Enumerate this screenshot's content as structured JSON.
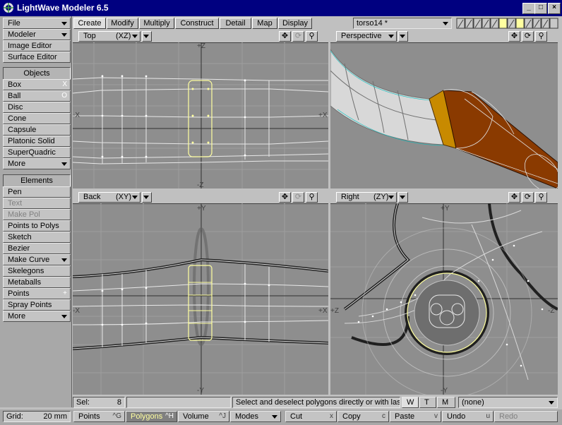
{
  "window": {
    "title": "LightWave Modeler 6.5"
  },
  "menus": {
    "file": "File",
    "modeler": "Modeler",
    "image_editor": "Image Editor",
    "surface_editor": "Surface Editor"
  },
  "objects": {
    "header": "Objects",
    "items": [
      {
        "label": "Box",
        "shortcut": "X"
      },
      {
        "label": "Ball",
        "shortcut": "O"
      },
      {
        "label": "Disc",
        "shortcut": ""
      },
      {
        "label": "Cone",
        "shortcut": ""
      },
      {
        "label": "Capsule",
        "shortcut": ""
      },
      {
        "label": "Platonic Solid",
        "shortcut": ""
      },
      {
        "label": "SuperQuadric",
        "shortcut": ""
      },
      {
        "label": "More",
        "shortcut": ""
      }
    ]
  },
  "elements": {
    "header": "Elements",
    "items": [
      {
        "label": "Pen"
      },
      {
        "label": "Text"
      },
      {
        "label": "Make Pol"
      },
      {
        "label": "Points to Polys"
      },
      {
        "label": "Sketch"
      },
      {
        "label": "Bezier"
      },
      {
        "label": "Make Curve"
      },
      {
        "label": "Skelegons"
      },
      {
        "label": "Metaballs"
      },
      {
        "label": "Points",
        "shortcut": "+"
      },
      {
        "label": "Spray Points"
      },
      {
        "label": "More"
      }
    ]
  },
  "tabs": [
    "Create",
    "Modify",
    "Multiply",
    "Construct",
    "Detail",
    "Map",
    "Display"
  ],
  "layer_select": "torso14 *",
  "viewports": {
    "top": {
      "label": "Top",
      "axes": "(XZ)",
      "axis_top": "+Z",
      "axis_bottom": "-Z",
      "axis_left": "-X",
      "axis_right": "+X"
    },
    "perspective": {
      "label": "Perspective"
    },
    "back": {
      "label": "Back",
      "axes": "(XY)",
      "axis_top": "+Y",
      "axis_bottom": "-Y",
      "axis_left": "-X",
      "axis_right": "+X"
    },
    "right": {
      "label": "Right",
      "axes": "(ZY)",
      "axis_top": "+Y",
      "axis_bottom": "-Y",
      "axis_left": "+Z",
      "axis_right": "-Z"
    }
  },
  "status": {
    "sel_label": "Sel:",
    "sel_value": "8",
    "message": "Select and deselect polygons directly or with las...",
    "wtm": [
      "W",
      "T",
      "M"
    ],
    "surface": "(none)"
  },
  "bottom": {
    "grid_label": "Grid:",
    "grid_value": "20 mm",
    "points": "Points",
    "points_sc": "^G",
    "polygons": "Polygons",
    "polygons_sc": "^H",
    "volume": "Volume",
    "volume_sc": "^J",
    "modes": "Modes",
    "cut": "Cut",
    "cut_sc": "x",
    "copy": "Copy",
    "copy_sc": "c",
    "paste": "Paste",
    "paste_sc": "v",
    "undo": "Undo",
    "undo_sc": "u",
    "redo": "Redo"
  },
  "colors": {
    "titlebar": "#000080",
    "viewport_bg": "#8e8e8e",
    "selection": "#ffffa0",
    "perspective_orange": "#8a3a00",
    "perspective_gold": "#c88a00"
  }
}
